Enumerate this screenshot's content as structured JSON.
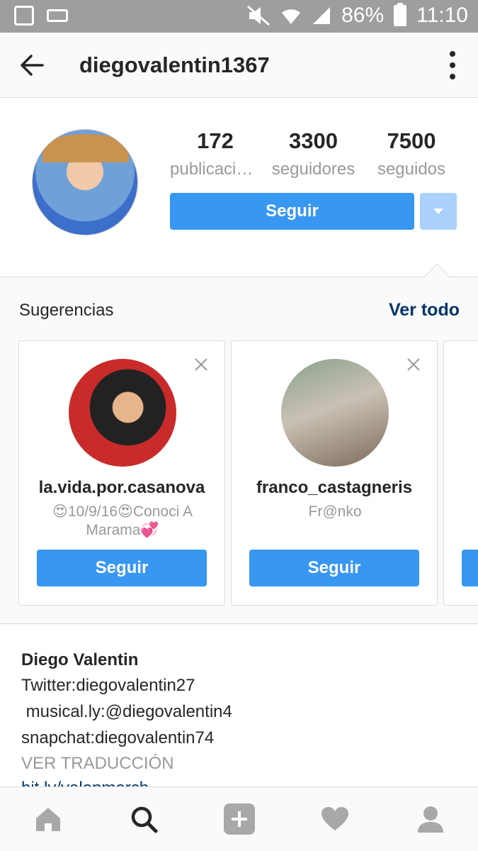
{
  "status_bar": {
    "battery": "86%",
    "time": "11:10"
  },
  "header": {
    "username": "diegovalentin1367"
  },
  "profile": {
    "stats": [
      {
        "number": "172",
        "label": "publicaciones"
      },
      {
        "number": "3300",
        "label": "seguidores"
      },
      {
        "number": "7500",
        "label": "seguidos"
      }
    ],
    "follow_label": "Seguir"
  },
  "suggestions": {
    "title": "Sugerencias",
    "see_all": "Ver todo",
    "cards": [
      {
        "username": "la.vida.por.casanova",
        "subtitle": "😍10/9/16😍Conoci A Marama💞",
        "button": "Seguir"
      },
      {
        "username": "franco_castagneris",
        "subtitle": "Fr@nko",
        "button": "Seguir"
      }
    ]
  },
  "bio": {
    "name": "Diego Valentin",
    "lines": [
      "Twitter:diegovalentin27",
      " musical.ly:@diegovalentin4",
      "snapchat:diegovalentin74"
    ],
    "translate": "VER TRADUCCIÓN",
    "link": "bit.ly/valenmerch"
  },
  "colors": {
    "accent": "#3897f0",
    "link": "#003569"
  }
}
